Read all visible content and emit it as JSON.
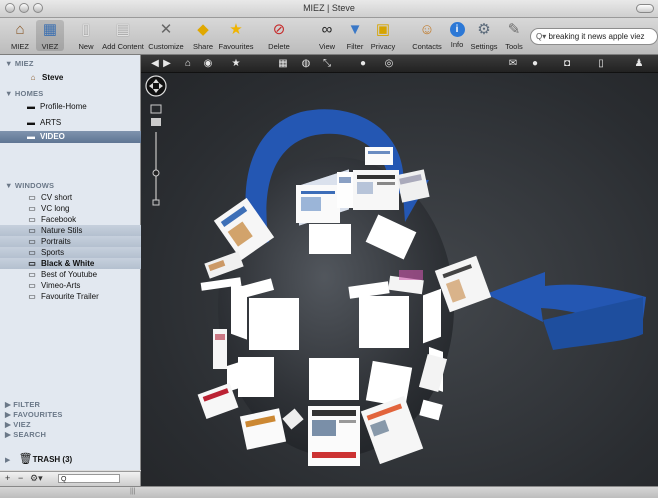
{
  "window": {
    "title": "MIEZ | Steve"
  },
  "toolbar": {
    "items": [
      {
        "label": "MIEZ",
        "icon": "home-icon"
      },
      {
        "label": "VIEZ",
        "icon": "viez-icon"
      },
      {
        "label": "New",
        "icon": "new-document-icon"
      },
      {
        "label": "Add Content",
        "icon": "add-content-icon"
      },
      {
        "label": "Customize",
        "icon": "tools-cross-icon"
      },
      {
        "label": "Share",
        "icon": "share-sign-icon"
      },
      {
        "label": "Favourites",
        "icon": "star-icon"
      },
      {
        "label": "Delete",
        "icon": "delete-icon"
      },
      {
        "label": "View",
        "icon": "binoculars-icon"
      },
      {
        "label": "Filter",
        "icon": "filter-icon"
      },
      {
        "label": "Privacy",
        "icon": "lock-icon"
      },
      {
        "label": "Contacts",
        "icon": "contacts-icon"
      },
      {
        "label": "Info",
        "icon": "info-icon"
      },
      {
        "label": "Settings",
        "icon": "gear-icon"
      },
      {
        "label": "Tools",
        "icon": "tools-icon"
      }
    ],
    "search_value": "breaking it news apple viez"
  },
  "sidebar": {
    "miez_header": "MIEZ",
    "miez_items": [
      {
        "label": "Steve"
      }
    ],
    "homes_header": "HOMES",
    "homes_items": [
      {
        "label": "Profile-Home"
      },
      {
        "label": "ARTS"
      },
      {
        "label": "VIDEO"
      }
    ],
    "windows_header": "WINDOWS",
    "windows_items": [
      {
        "label": "CV short"
      },
      {
        "label": "VC long"
      },
      {
        "label": "Facebook"
      },
      {
        "label": "Nature Stils"
      },
      {
        "label": "Portraits"
      },
      {
        "label": "Sports"
      },
      {
        "label": "Black & White"
      },
      {
        "label": "Best of Youtube"
      },
      {
        "label": "Vimeo-Arts"
      },
      {
        "label": "Favourite Trailer"
      }
    ],
    "collapsed_sections": [
      {
        "label": "FILTER"
      },
      {
        "label": "FAVOURITES"
      },
      {
        "label": "VIEZ"
      },
      {
        "label": "SEARCH"
      }
    ],
    "trash_label": "TRASH (3)"
  },
  "viewer": {
    "toolbar_icons": [
      "back-icon",
      "forward-icon",
      "home-icon",
      "record-icon",
      "star-icon",
      "grid-icon",
      "globe-icon",
      "expand-icon",
      "download-icon",
      "compass-icon",
      "mail-icon",
      "chat-icon",
      "camera-icon",
      "clipboard-icon",
      "user-icon"
    ]
  },
  "colors": {
    "viewer_bg": "#2a2d31",
    "arrow_blue": "#2457b3",
    "sidebar_bg": "#e2e8f0",
    "selection": "#5e7593",
    "status_dot": "#2fbf3a"
  }
}
